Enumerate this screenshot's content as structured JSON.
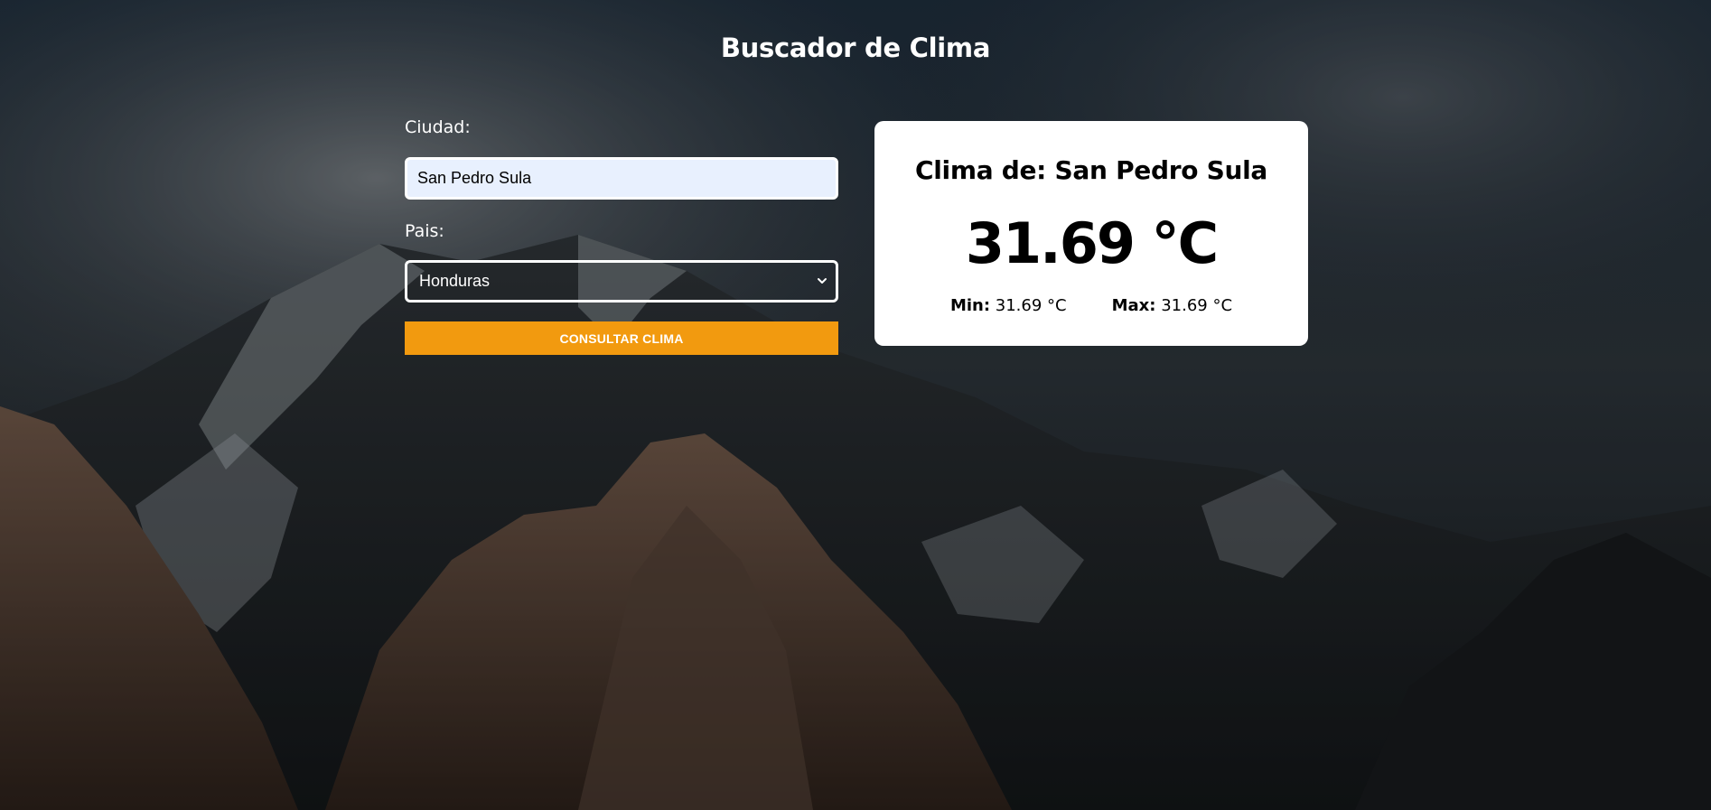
{
  "app": {
    "title": "Buscador de Clima"
  },
  "form": {
    "city_label": "Ciudad:",
    "city_value": "San Pedro Sula",
    "country_label": "Pais:",
    "country_selected": "Honduras",
    "submit_label": "CONSULTAR CLIMA"
  },
  "result": {
    "heading": "Clima de: San Pedro Sula",
    "temperature": "31.69 °C",
    "min_label": "Min:",
    "min_value": "31.69 °C",
    "max_label": "Max:",
    "max_value": "31.69 °C"
  },
  "icons": {
    "select_arrow": "chevron-down-icon"
  },
  "colors": {
    "button": "#f29a0f",
    "input_background": "#e8f0fe",
    "card": "#ffffff",
    "text_light": "#ffffff",
    "text_dark": "#000000"
  }
}
